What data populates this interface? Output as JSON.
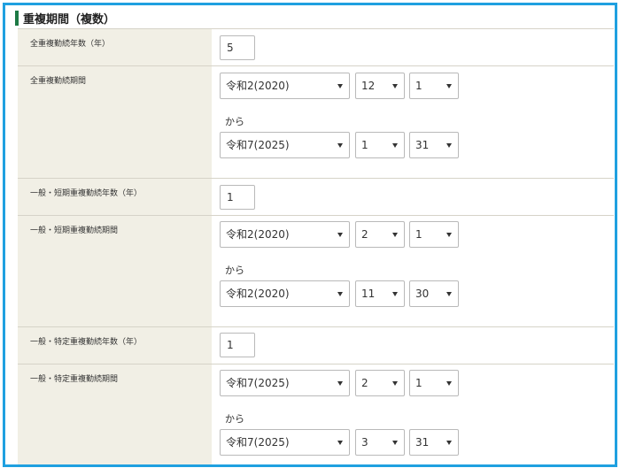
{
  "section": {
    "title": "重複期間（複数）"
  },
  "rows": [
    {
      "label": "全重複勤続年数（年）",
      "value": "5"
    },
    {
      "label": "全重複勤続期間",
      "from": {
        "era": "令和2(2020)",
        "month": "12",
        "day": "1"
      },
      "separator": "から",
      "to": {
        "era": "令和7(2025)",
        "month": "1",
        "day": "31"
      }
    },
    {
      "label": "一般・短期重複勤続年数（年）",
      "value": "1"
    },
    {
      "label": "一般・短期重複勤続期間",
      "from": {
        "era": "令和2(2020)",
        "month": "2",
        "day": "1"
      },
      "separator": "から",
      "to": {
        "era": "令和2(2020)",
        "month": "11",
        "day": "30"
      }
    },
    {
      "label": "一般・特定重複勤続年数（年）",
      "value": "1"
    },
    {
      "label": "一般・特定重複勤続期間",
      "from": {
        "era": "令和7(2025)",
        "month": "2",
        "day": "1"
      },
      "separator": "から",
      "to": {
        "era": "令和7(2025)",
        "month": "3",
        "day": "31"
      }
    }
  ],
  "colors": {
    "frame_border": "#1fa0e0",
    "title_marker": "#1d7a45",
    "label_bg": "#f1efe5"
  }
}
